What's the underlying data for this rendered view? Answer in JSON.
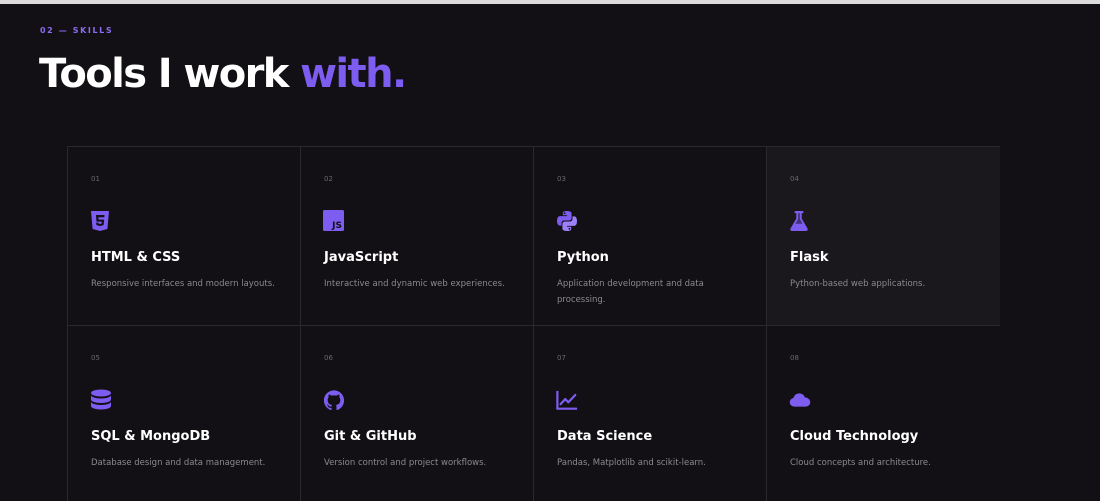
{
  "section": {
    "eyebrow": "02 — SKILLS",
    "heading_main": "Tools I work ",
    "heading_accent": "with."
  },
  "colors": {
    "background": "#121014",
    "accent": "#7d5cf0",
    "card_border": "#2a282c"
  },
  "skills": [
    {
      "num": "01",
      "icon": "html5-icon",
      "title": "HTML & CSS",
      "desc": "Responsive interfaces and modern layouts."
    },
    {
      "num": "02",
      "icon": "javascript-icon",
      "title": "JavaScript",
      "desc": "Interactive and dynamic web experiences."
    },
    {
      "num": "03",
      "icon": "python-icon",
      "title": "Python",
      "desc": "Application development and data processing."
    },
    {
      "num": "04",
      "icon": "flask-icon",
      "title": "Flask",
      "desc": "Python-based web applications."
    },
    {
      "num": "05",
      "icon": "database-icon",
      "title": "SQL & MongoDB",
      "desc": "Database design and data management."
    },
    {
      "num": "06",
      "icon": "github-icon",
      "title": "Git & GitHub",
      "desc": "Version control and project workflows."
    },
    {
      "num": "07",
      "icon": "line-chart-icon",
      "title": "Data Science",
      "desc": "Pandas, Matplotlib and scikit-learn."
    },
    {
      "num": "08",
      "icon": "cloud-icon",
      "title": "Cloud Technology",
      "desc": "Cloud concepts and architecture."
    }
  ]
}
